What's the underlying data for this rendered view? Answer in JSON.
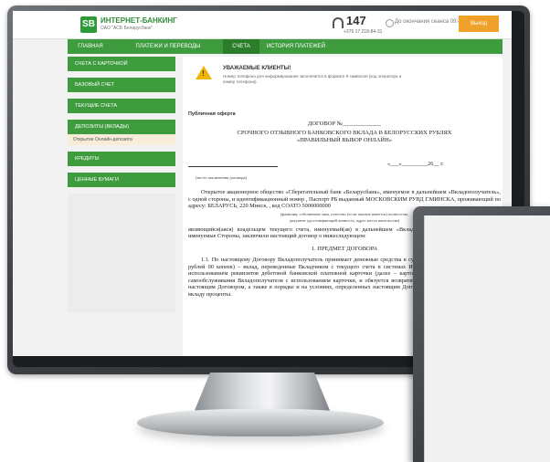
{
  "header": {
    "logo_mark": "SB",
    "brand_title": "ИНТЕРНЕТ-БАНКИНГ",
    "brand_subtitle": "ОАО \"АСБ Беларусбанк\"",
    "phone_number": "147",
    "phone_sub": "+375 17 218-84-31",
    "session_text": "До окончания сеанса 09:48",
    "exit_label": "Выход"
  },
  "nav": {
    "items": [
      {
        "label": "ГЛАВНАЯ"
      },
      {
        "label": "ПЛАТЕЖИ И ПЕРЕВОДЫ"
      },
      {
        "label": "СЧЕТА"
      },
      {
        "label": "ИСТОРИЯ ПЛАТЕЖЕЙ"
      }
    ]
  },
  "sidebar": {
    "items": [
      {
        "label": "СЧЕТА С КАРТОЧКОЙ"
      },
      {
        "label": "БАЗОВЫЙ СЧЕТ"
      },
      {
        "label": "ТЕКУЩИЕ СЧЕТА"
      },
      {
        "label": "ДЕПОЗИТЫ (ВКЛАДЫ)"
      },
      {
        "label": "КРЕДИТЫ"
      },
      {
        "label": "ЦЕННЫЕ БУМАГИ"
      }
    ],
    "sub_item": "Открытие Онлайн-депозита"
  },
  "notice": {
    "title": "УВАЖАЕМЫЕ КЛИЕНТЫ!",
    "text": "Номер телефона для информирования заполняется в формате 9 символов (код оператора и номер телефона)."
  },
  "document": {
    "label": "Публичная оферта",
    "contract_no": "ДОГОВОР №_____________",
    "heading_1": "СРОЧНОГО ОТЗЫВНОГО БАНКОВСКОГО ВКЛАДА В БЕЛОРУССКИХ РУБЛЯХ",
    "heading_2": "«ПРАВИЛЬНЫЙ ВЫБОР ОНЛАЙН»",
    "date_line": "«___»_________26__ г.",
    "place_caption": "(место заключения договора)",
    "para_1": "Открытое акционерное общество «Сберегательный банк «Беларусбанк», именуемое в дальнейшем «Вкладополучатель», с одной стороны, и идентификационный номер , Паспорт РБ выданный МОСКОВСКИМ РУВД Г.МИНСКА, проживающий по адресу: БЕЛАРУСЬ, 220 Минск, , код СОАТО 5000000000",
    "caption_1": "(фамилия, собственное имя, отчество (если таковое имеется) полностью,",
    "caption_2": "документ удостоверяющий личность, адрес места жительства)",
    "para_2": "являющийся(аяся) владельцем текущего счета, именуемый(ая) в дальнейшем «Вкладчик», с другой стороны, вместе именуемые Стороны, заключили настоящий договор о нижеследующем:",
    "section_1": "1. ПРЕДМЕТ ДОГОВОРА",
    "para_3": "1.1. По настоящему Договору Вкладополучатель принимает денежные средства в сумме 50.00 (Пятьдесят белорусских рублей 00 копеек) – вклад, переведенные Вкладчиком с текущего счета в системах Интернет-банкинг или М-банкинг с использованием реквизитов дебетовой банковской платежной карточки (далее – карточка), к текущему счету, в пункте самообслуживания Вкладополучателя с использованием карточки, и обязуется возвратить сумму вклада в соответствии с настоящим Договором, а также в порядке и на условиях, определенных настоящим Договором, выплатить начисленные по вкладу проценты."
  }
}
